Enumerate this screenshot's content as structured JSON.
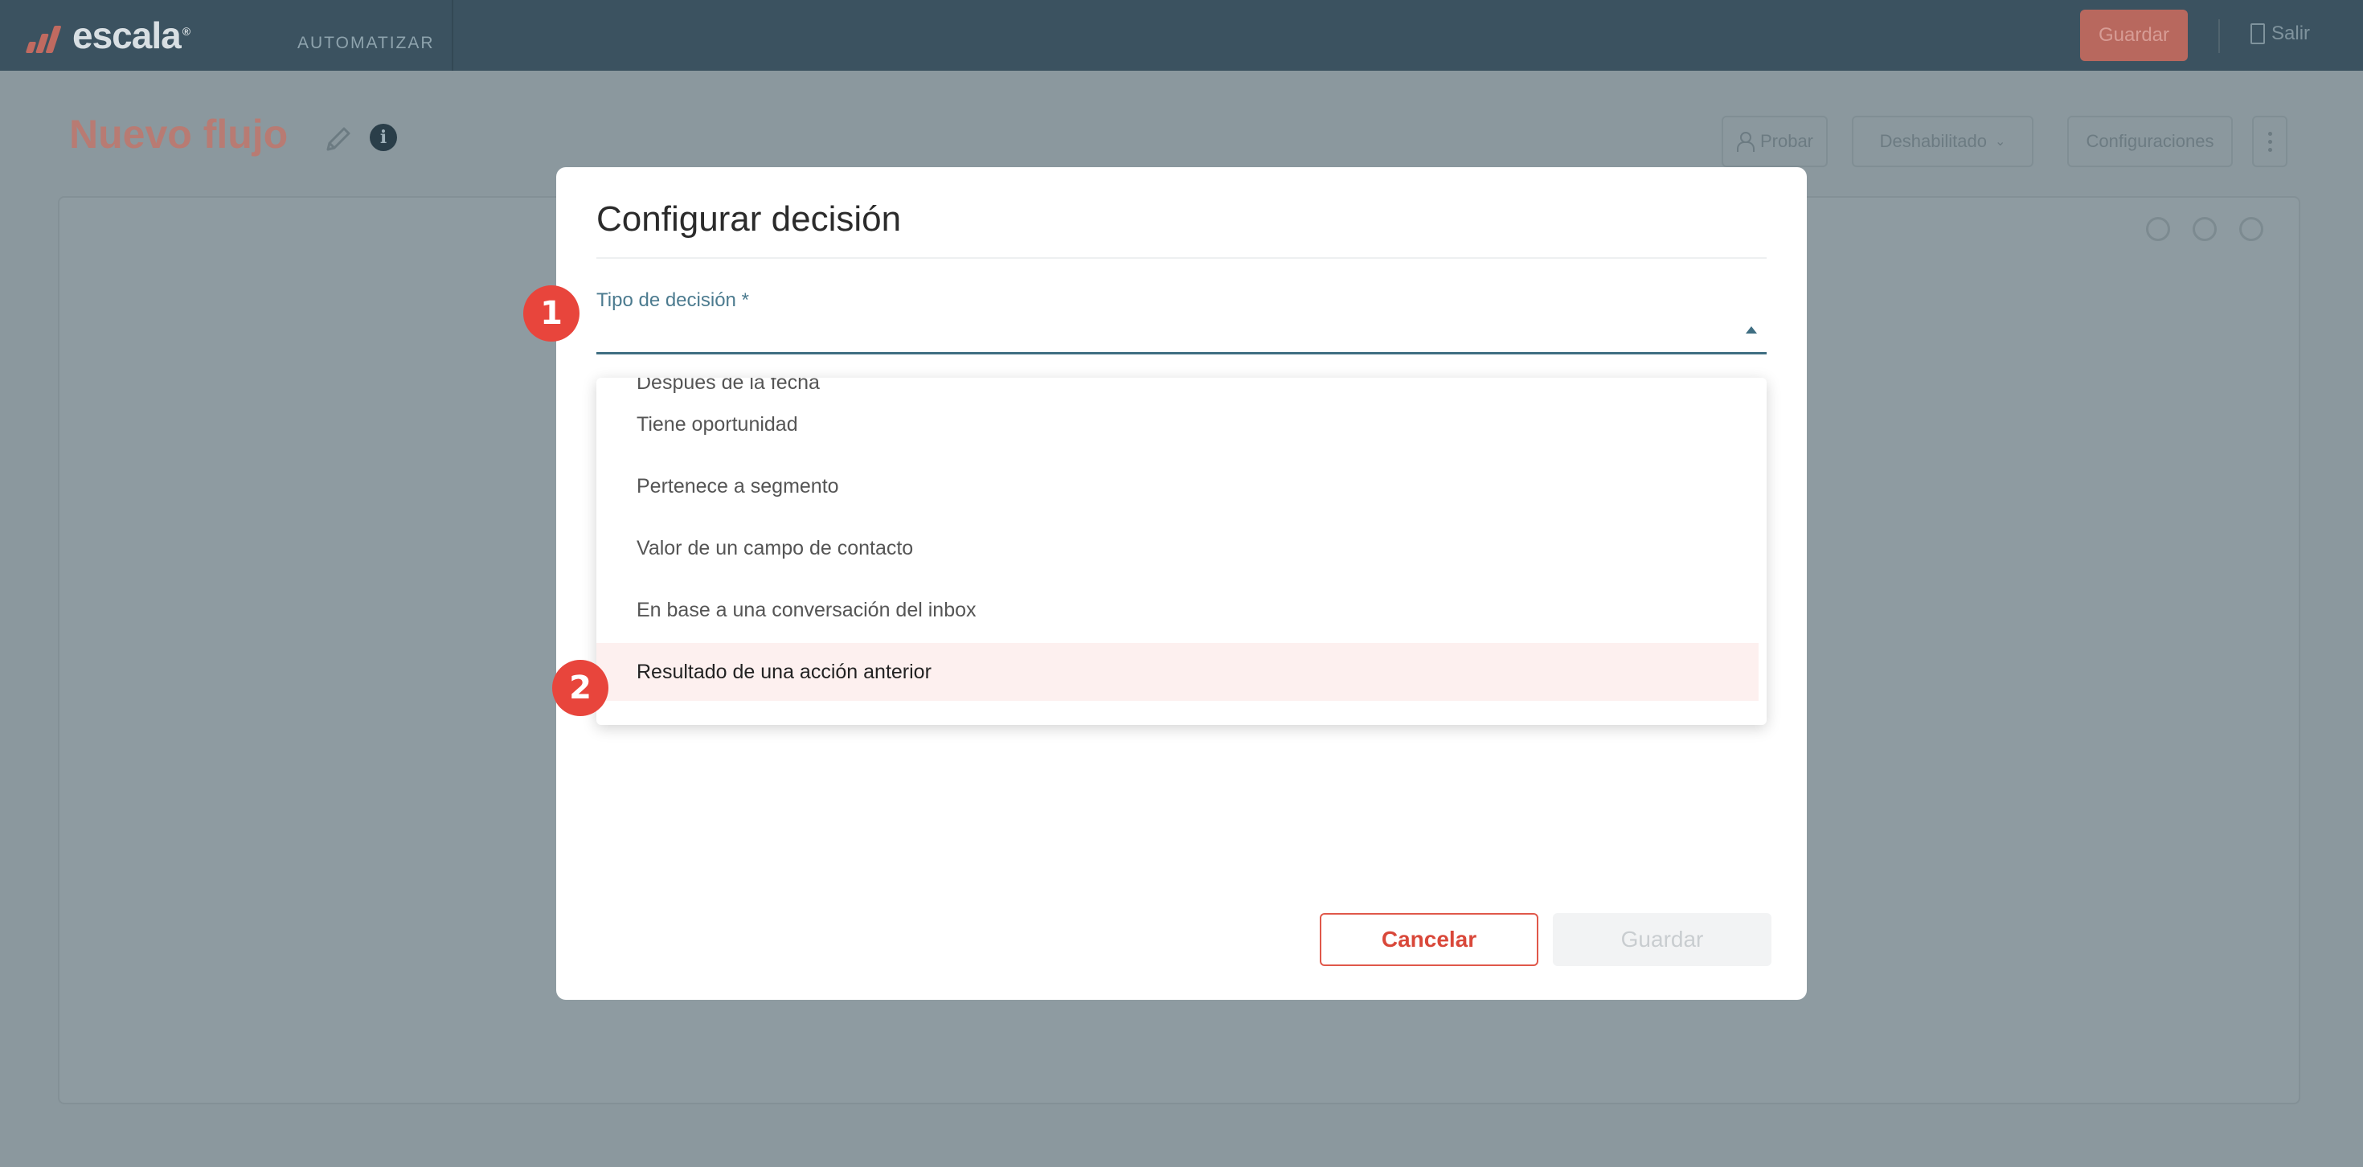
{
  "header": {
    "logo_text": "escala",
    "logo_mark": "®",
    "nav_label": "AUTOMATIZAR",
    "save_label": "Guardar",
    "exit_label": "Salir"
  },
  "flow": {
    "title": "Nuevo flujo",
    "test_label": "Probar",
    "status_label": "Deshabilitado",
    "settings_label": "Configuraciones"
  },
  "modal": {
    "title": "Configurar decisión",
    "field_label": "Tipo de decisión",
    "required_mark": "*",
    "field_value": "",
    "options": [
      "Después de la fecha",
      "Tiene oportunidad",
      "Pertenece a segmento",
      "Valor de un campo de contacto",
      "En base a una conversación del inbox",
      "Resultado de una acción anterior"
    ],
    "highlighted_option_index": 5,
    "cancel_label": "Cancelar",
    "save_label": "Guardar"
  },
  "annotations": {
    "step1": "1",
    "step2": "2"
  },
  "colors": {
    "accent": "#e8453c",
    "primary_dark": "#3b5260",
    "highlight_bg": "#fdf0ef",
    "field_line": "#3f6e82"
  }
}
